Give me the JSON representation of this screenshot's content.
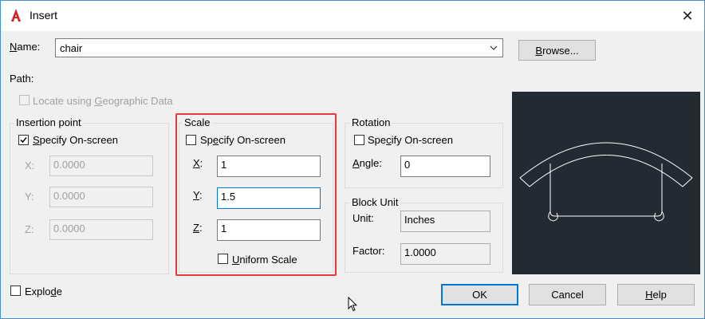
{
  "window": {
    "title": "Insert"
  },
  "name_row": {
    "label": "Name:",
    "value": "chair",
    "browse_label": "Browse..."
  },
  "path": {
    "label": "Path:"
  },
  "geo": {
    "label": "Locate using Geographic Data",
    "checked": false,
    "enabled": false
  },
  "insertion_point": {
    "title": "Insertion point",
    "specify_label": "Specify On-screen",
    "specify_checked": true,
    "x": {
      "label": "X:",
      "value": "0.0000"
    },
    "y": {
      "label": "Y:",
      "value": "0.0000"
    },
    "z": {
      "label": "Z:",
      "value": "0.0000"
    }
  },
  "scale": {
    "title": "Scale",
    "specify_label": "Specify On-screen",
    "specify_checked": false,
    "x": {
      "label": "X:",
      "value": "1"
    },
    "y": {
      "label": "Y:",
      "value": "1.5"
    },
    "z": {
      "label": "Z:",
      "value": "1"
    },
    "uniform_label": "Uniform Scale",
    "uniform_checked": false
  },
  "rotation": {
    "title": "Rotation",
    "specify_label": "Specify On-screen",
    "specify_checked": false,
    "angle_label": "Angle:",
    "angle_value": "0"
  },
  "block_unit": {
    "title": "Block Unit",
    "unit_label": "Unit:",
    "unit_value": "Inches",
    "factor_label": "Factor:",
    "factor_value": "1.0000"
  },
  "explode": {
    "label": "Explode",
    "checked": false
  },
  "buttons": {
    "ok": "OK",
    "cancel": "Cancel",
    "help": "Help"
  },
  "colors": {
    "accent": "#0078d7",
    "highlight": "#e33b3b",
    "preview_bg": "#232a34"
  }
}
